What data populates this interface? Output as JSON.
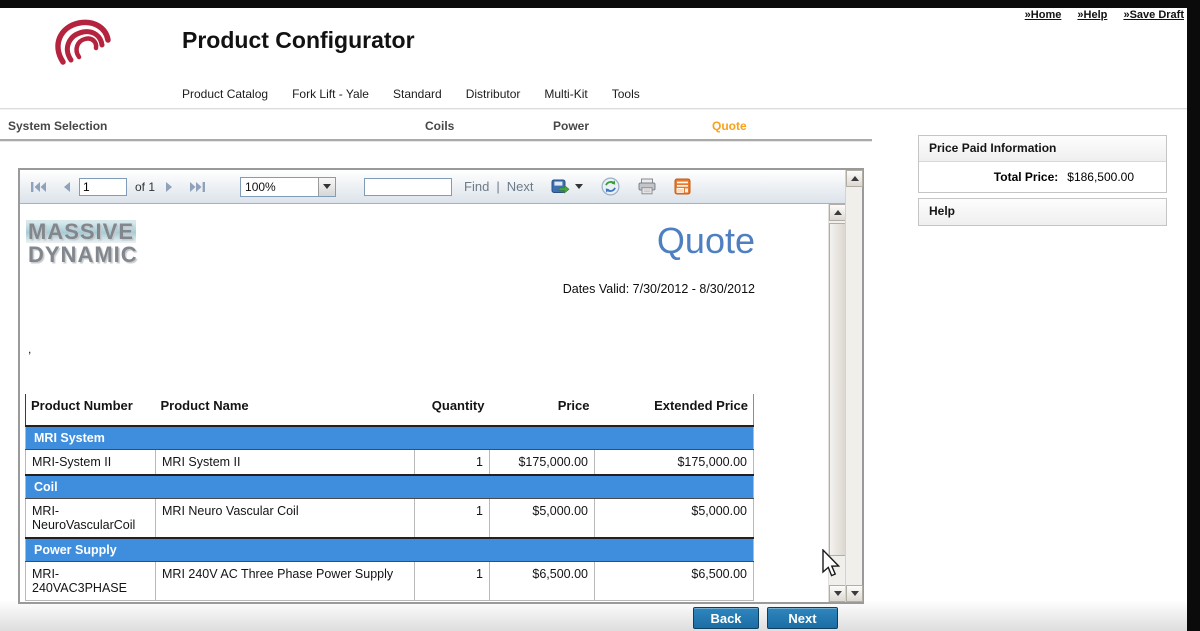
{
  "chrome": {
    "home": "»Home",
    "help": "»Help",
    "save_draft": "»Save Draft"
  },
  "header": {
    "title": "Product Configurator"
  },
  "menu": {
    "items": [
      "Product Catalog",
      "Fork Lift - Yale",
      "Standard",
      "Distributor",
      "Multi-Kit",
      "Tools"
    ]
  },
  "tabs": {
    "system_selection": "System Selection",
    "coils": "Coils",
    "power": "Power",
    "quote": "Quote"
  },
  "toolbar": {
    "page_value": "1",
    "of_label": "of 1",
    "zoom_value": "100%",
    "find_value": "",
    "find_label": "Find",
    "separator": "|",
    "next_label": "Next"
  },
  "report": {
    "logo_line1": "MASSIVE",
    "logo_line2": "DYNAMIC",
    "title": "Quote",
    "dates_valid": "Dates Valid: 7/30/2012 - 8/30/2012",
    "address_note": ",",
    "table": {
      "headers": [
        "Product Number",
        "Product Name",
        "Quantity",
        "Price",
        "Extended Price"
      ],
      "groups": [
        {
          "name": "MRI System",
          "row": {
            "number": "MRI-System II",
            "name": "MRI System II",
            "qty": "1",
            "price": "$175,000.00",
            "extended": "$175,000.00"
          }
        },
        {
          "name": "Coil",
          "row": {
            "number": "MRI-NeuroVascularCoil",
            "name": "MRI Neuro Vascular Coil",
            "qty": "1",
            "price": "$5,000.00",
            "extended": "$5,000.00"
          }
        },
        {
          "name": "Power Supply",
          "row": {
            "number": "MRI-240VAC3PHASE",
            "name": "MRI 240V AC Three Phase Power Supply",
            "qty": "1",
            "price": "$6,500.00",
            "extended": "$6,500.00"
          }
        }
      ]
    }
  },
  "sidebar": {
    "price_box_title": "Price Paid Information",
    "total_label": "Total Price:",
    "total_value": "$186,500.00",
    "help_title": "Help"
  },
  "footer": {
    "back": "Back",
    "next": "Next"
  },
  "colors": {
    "tab_active_orange": "#F9A11B",
    "group_header_blue": "#3F8EDE",
    "quote_title_blue": "#4D7FC1",
    "footer_button_blue": "#1E76AD",
    "logo_red": "#B5243E"
  }
}
